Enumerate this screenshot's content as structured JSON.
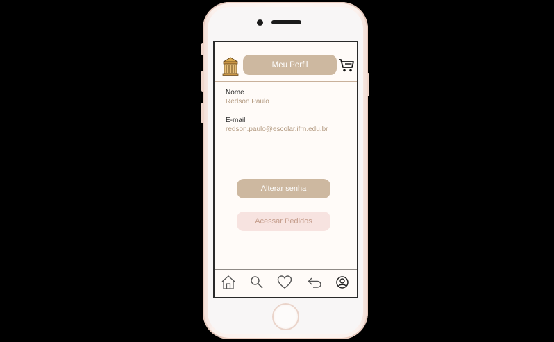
{
  "header": {
    "title": "Meu Perfil",
    "logo_icon": "store-building-icon",
    "cart_icon": "shopping-cart-icon"
  },
  "profile": {
    "name_label": "Nome",
    "name_value": "Redson Paulo",
    "email_label": "E-mail",
    "email_value": "redson.paulo@escolar.ifrn.edu.br"
  },
  "actions": {
    "change_password": "Alterar senha",
    "view_orders": "Acessar Pedidos"
  },
  "nav": {
    "items": [
      {
        "icon": "home-icon"
      },
      {
        "icon": "search-icon"
      },
      {
        "icon": "heart-icon"
      },
      {
        "icon": "back-arrow-icon"
      },
      {
        "icon": "profile-icon"
      }
    ]
  },
  "colors": {
    "accent": "#cdb8a0",
    "accent_text": "#b49b82",
    "secondary_bg": "#f7e3e0",
    "screen_bg": "#fffbf8"
  }
}
